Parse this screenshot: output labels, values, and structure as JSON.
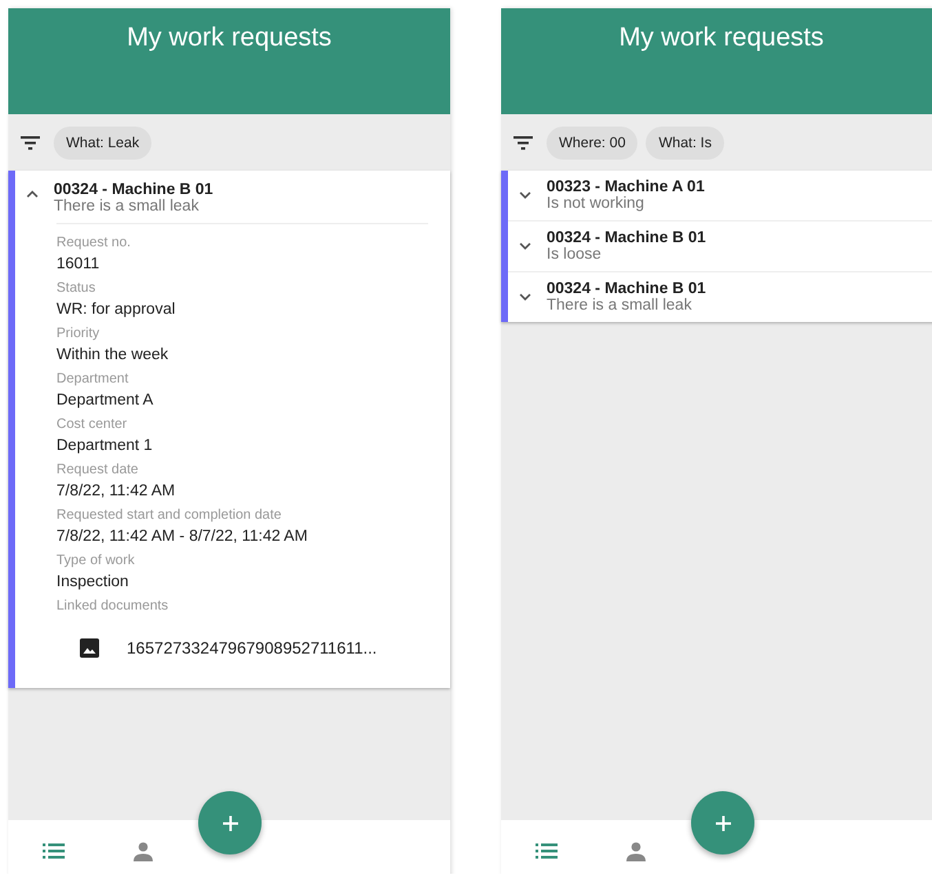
{
  "screens": [
    {
      "title": "My work requests",
      "filters": [
        {
          "label": "What: Leak"
        }
      ],
      "requests": [
        {
          "title": "00324 - Machine B 01",
          "description": "There is a small leak",
          "expanded": true,
          "details": [
            {
              "label": "Request no.",
              "value": "16011"
            },
            {
              "label": "Status",
              "value": "WR: for approval"
            },
            {
              "label": "Priority",
              "value": "Within the week"
            },
            {
              "label": "Department",
              "value": "Department A"
            },
            {
              "label": "Cost center",
              "value": "Department 1"
            },
            {
              "label": "Request date",
              "value": "7/8/22, 11:42 AM"
            },
            {
              "label": "Requested start and completion date",
              "value": "7/8/22, 11:42 AM - 8/7/22, 11:42 AM"
            },
            {
              "label": "Type of work",
              "value": "Inspection"
            }
          ],
          "documents_label": "Linked documents",
          "documents": [
            {
              "name": "16572733247967908952711611..."
            }
          ]
        }
      ],
      "nav": [
        {
          "kind": "list",
          "selected": true
        },
        {
          "kind": "person",
          "selected": false
        }
      ]
    },
    {
      "title": "My work requests",
      "filters": [
        {
          "label": "Where: 00"
        },
        {
          "label": "What: Is"
        }
      ],
      "requests": [
        {
          "title": "00323 - Machine A 01",
          "description": "Is not working",
          "expanded": false
        },
        {
          "title": "00324 - Machine B 01",
          "description": "Is loose",
          "expanded": false
        },
        {
          "title": "00324 - Machine B 01",
          "description": "There is a small leak",
          "expanded": false
        }
      ],
      "nav": [
        {
          "kind": "list",
          "selected": true
        },
        {
          "kind": "person",
          "selected": false
        }
      ]
    }
  ]
}
